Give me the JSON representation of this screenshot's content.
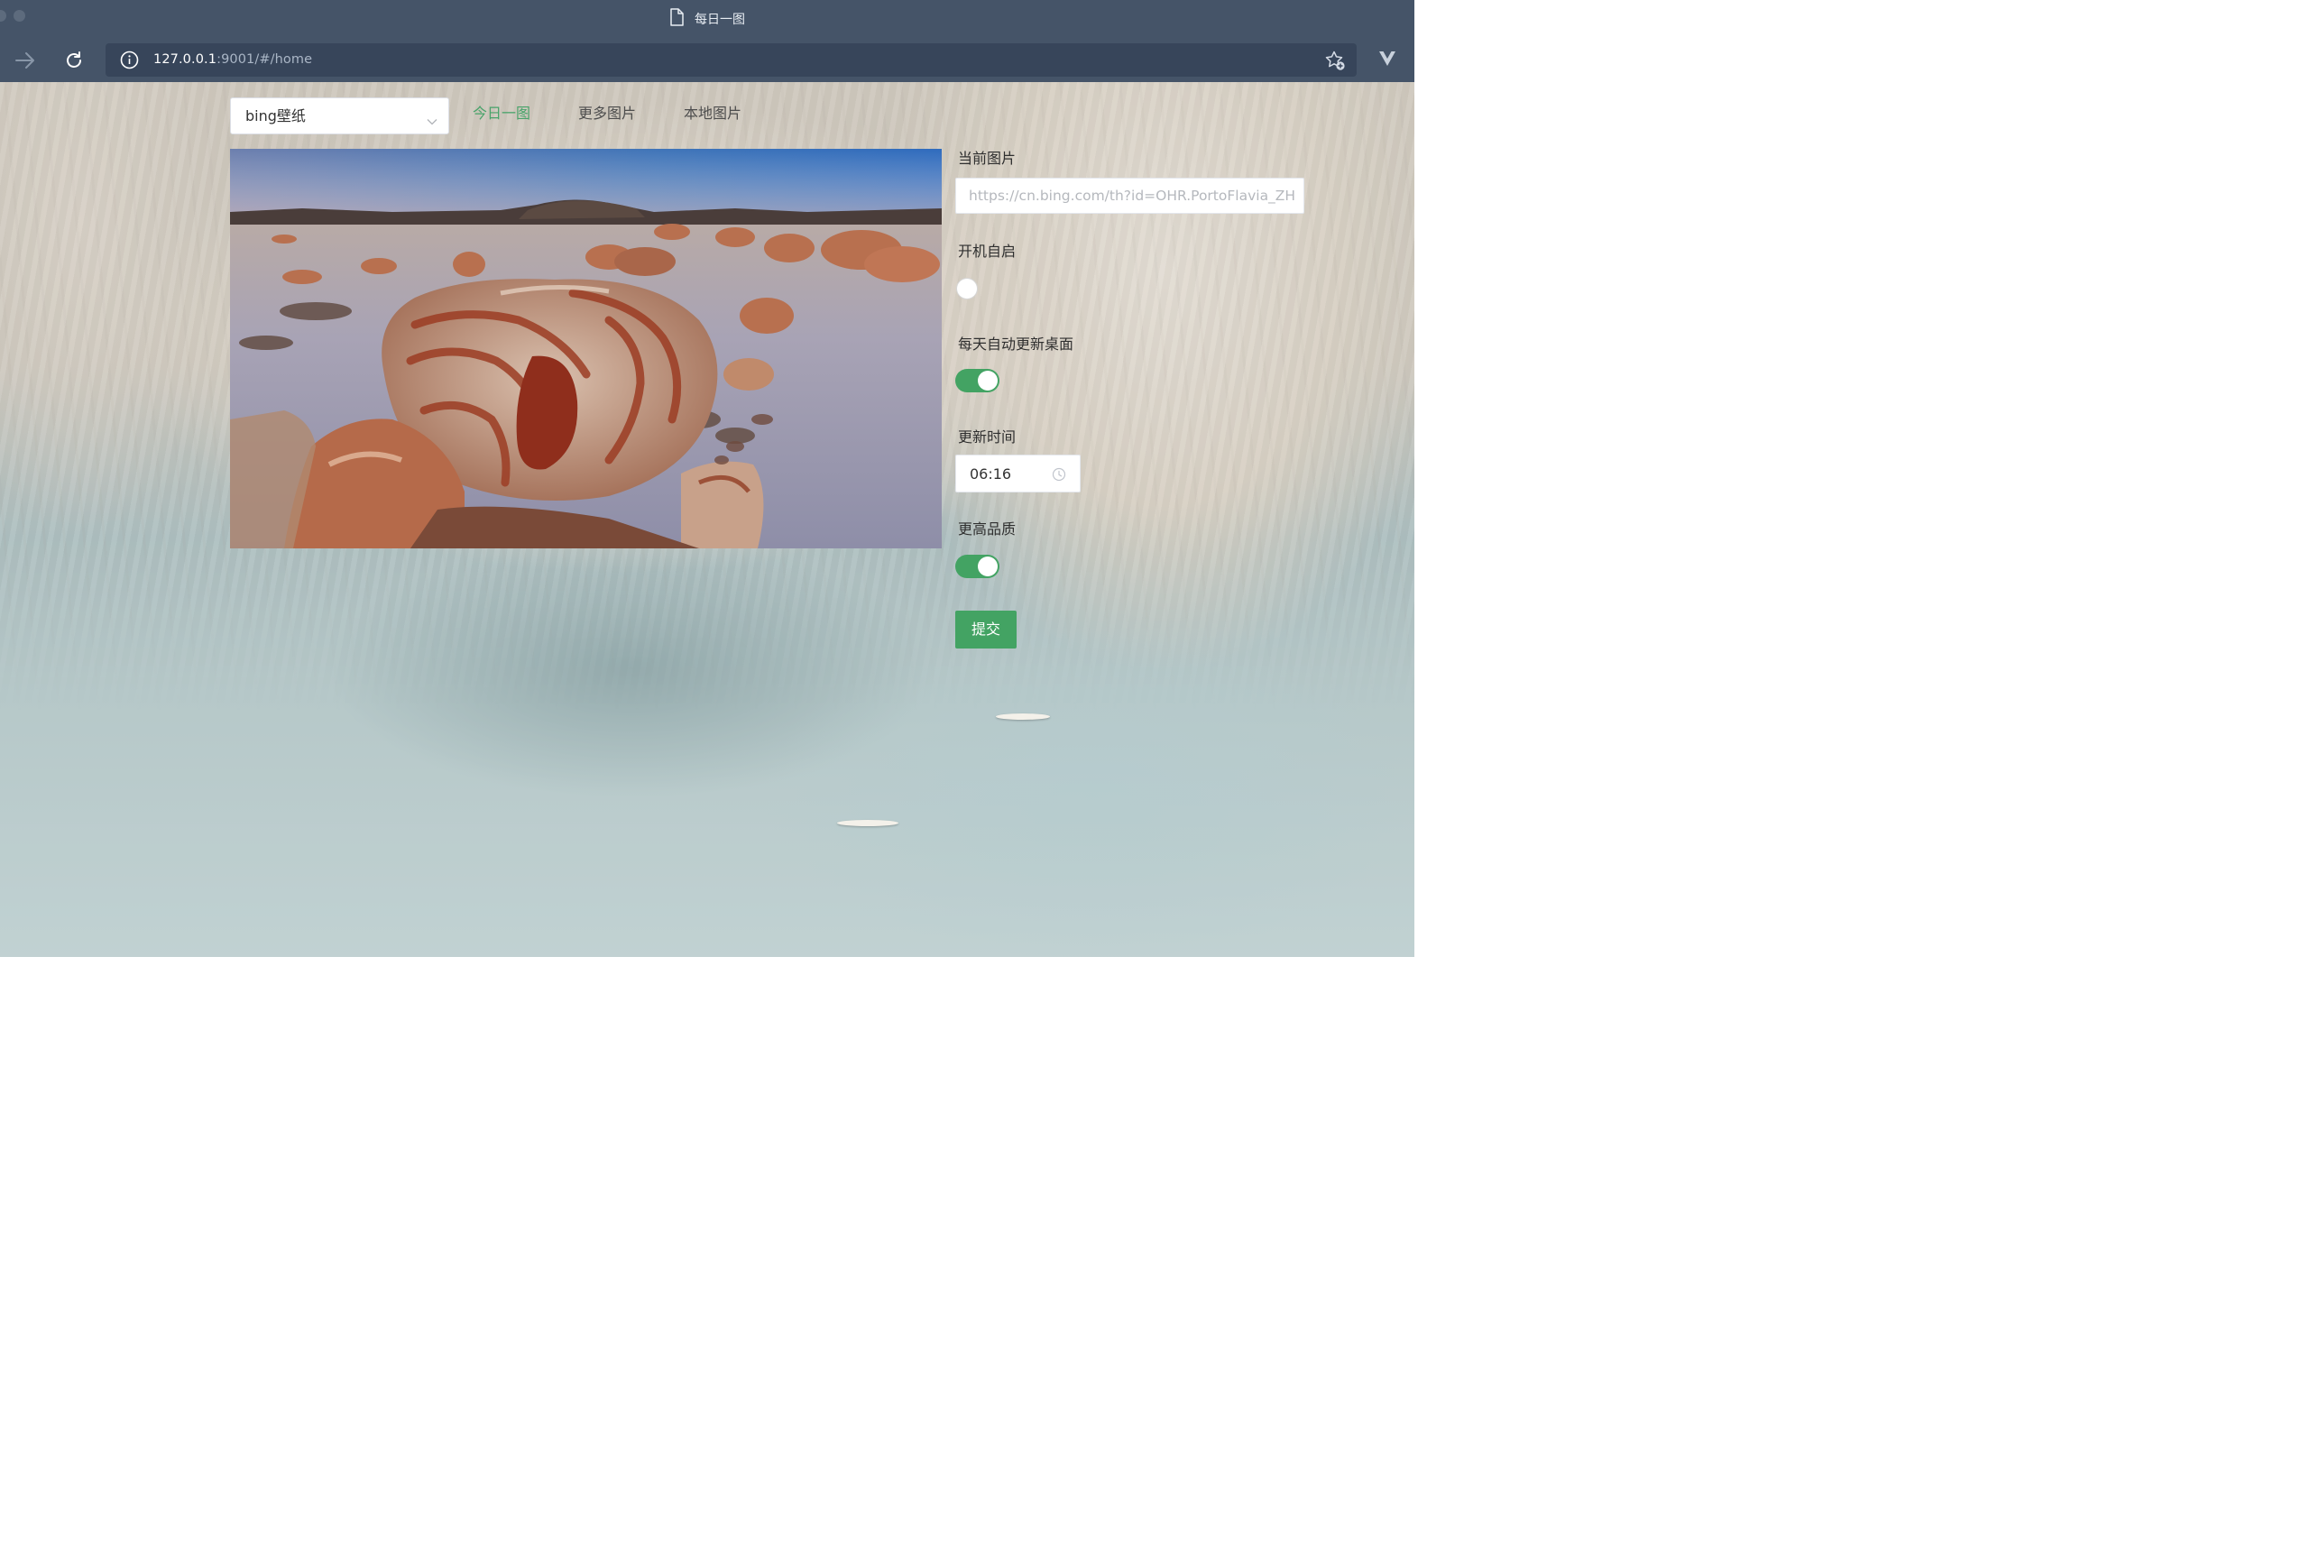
{
  "window": {
    "title": "每日一图"
  },
  "browser": {
    "url_host": "127.0.0.1",
    "url_rest": ":9001/#/home"
  },
  "nav": {
    "source_select": "bing壁纸",
    "menu": [
      {
        "label": "今日一图",
        "active": true
      },
      {
        "label": "更多图片",
        "active": false
      },
      {
        "label": "本地图片",
        "active": false
      }
    ]
  },
  "settings": {
    "current_image_label": "当前图片",
    "current_image_value": "https://cn.bing.com/th?id=OHR.PortoFlavia_ZH",
    "autostart_label": "开机自启",
    "autostart_on": false,
    "auto_update_label": "每天自动更新桌面",
    "auto_update_on": true,
    "update_time_label": "更新时间",
    "update_time_value": "06:16",
    "high_quality_label": "更高品质",
    "high_quality_on": true,
    "submit_label": "提交"
  },
  "icons": {
    "doc": "document-icon",
    "forward": "forward-arrow-icon",
    "reload": "reload-icon",
    "info": "info-icon",
    "bookmark": "bookmark-star-icon",
    "brand": "vivaldi-icon",
    "select_arrow": "chevron-down-icon",
    "clock": "clock-icon"
  },
  "colors": {
    "accent": "#43a363",
    "chrome": "#455468",
    "urlbar": "#37455a"
  }
}
